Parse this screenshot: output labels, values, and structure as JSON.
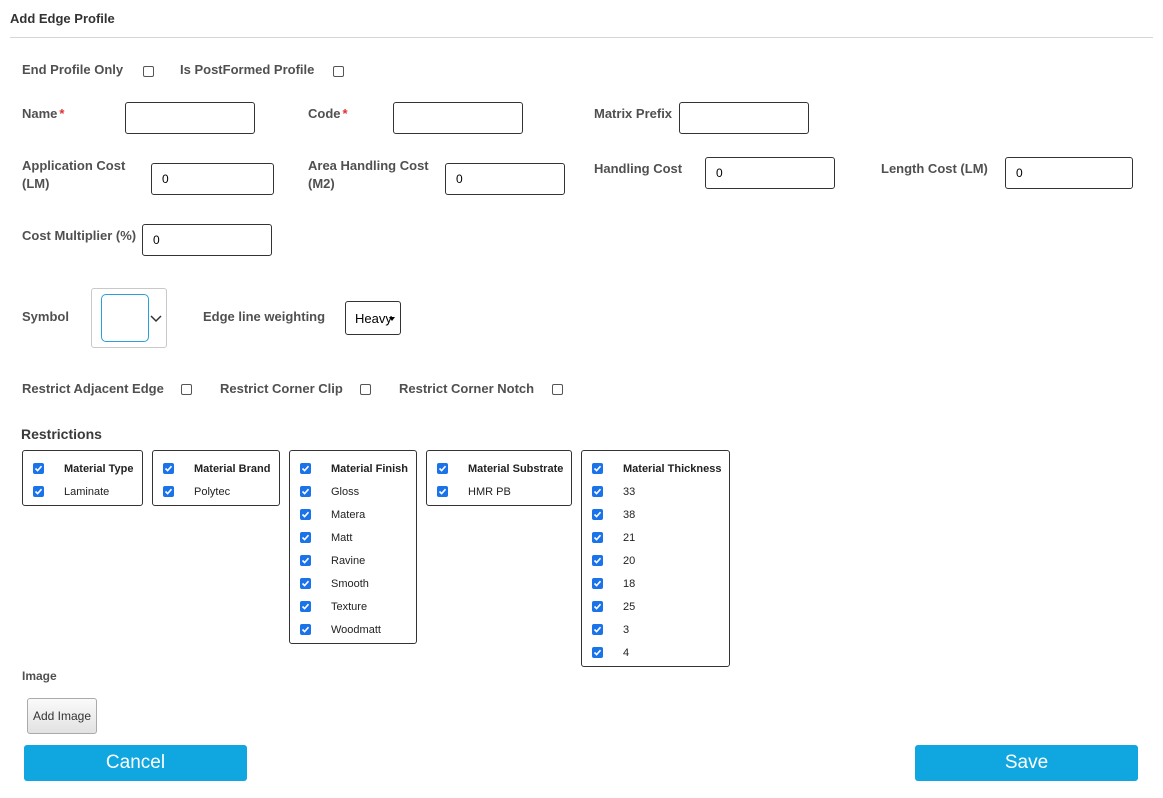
{
  "header": {
    "title": "Add Edge Profile"
  },
  "flags": {
    "end_profile_only": {
      "label": "End Profile Only",
      "checked": false
    },
    "is_postformed": {
      "label": "Is PostFormed Profile",
      "checked": false
    }
  },
  "fields": {
    "name": {
      "label": "Name",
      "required_mark": "*",
      "value": ""
    },
    "code": {
      "label": "Code",
      "required_mark": "*",
      "value": ""
    },
    "matrix_prefix": {
      "label": "Matrix Prefix",
      "value": ""
    },
    "application_cost": {
      "label_line1": "Application Cost",
      "label_line2": "(LM)",
      "value": "0"
    },
    "area_handling_cost": {
      "label_line1": "Area Handling Cost",
      "label_line2": "(M2)",
      "value": "0"
    },
    "handling_cost": {
      "label": "Handling Cost",
      "value": "0"
    },
    "length_cost": {
      "label": "Length Cost (LM)",
      "value": "0"
    },
    "cost_multiplier": {
      "label": "Cost Multiplier (%)",
      "value": "0"
    }
  },
  "symbol": {
    "label": "Symbol",
    "icon": "chevron-down-icon"
  },
  "edge_line": {
    "label": "Edge line weighting",
    "value": "Heavy"
  },
  "restrict": {
    "adjacent_edge": {
      "label": "Restrict Adjacent Edge",
      "checked": false
    },
    "corner_clip": {
      "label": "Restrict Corner Clip",
      "checked": false
    },
    "corner_notch": {
      "label": "Restrict Corner Notch",
      "checked": false
    }
  },
  "restrictions": {
    "title": "Restrictions",
    "check_color": "#1a73e8",
    "groups": [
      {
        "header": "Material Type",
        "items": [
          "Laminate"
        ]
      },
      {
        "header": "Material Brand",
        "items": [
          "Polytec"
        ]
      },
      {
        "header": "Material Finish",
        "items": [
          "Gloss",
          "Matera",
          "Matt",
          "Ravine",
          "Smooth",
          "Texture",
          "Woodmatt"
        ]
      },
      {
        "header": "Material Substrate",
        "items": [
          "HMR PB"
        ]
      },
      {
        "header": "Material Thickness",
        "items": [
          "33",
          "38",
          "21",
          "20",
          "18",
          "25",
          "3",
          "4"
        ]
      }
    ]
  },
  "image": {
    "label": "Image",
    "add_button": "Add Image"
  },
  "footer": {
    "cancel": "Cancel",
    "save": "Save",
    "button_color": "#10a6df"
  }
}
